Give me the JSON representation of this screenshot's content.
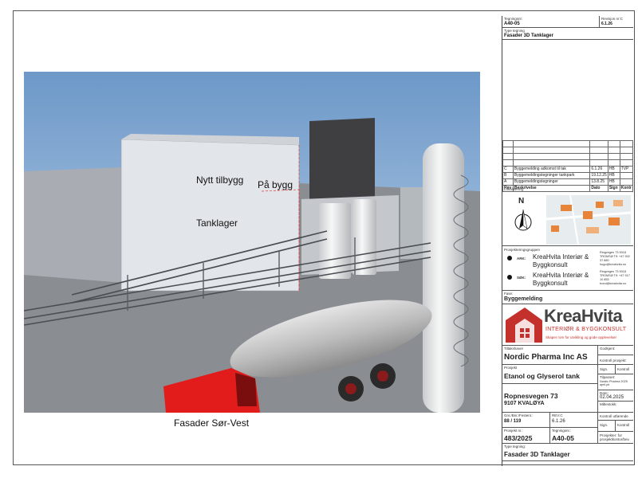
{
  "drawing": {
    "caption": "Fasader Sør-Vest",
    "labels": {
      "new_building": "Nytt tilbygg",
      "on_building": "På bygg",
      "tank_storage": "Tanklager"
    }
  },
  "title_block": {
    "header": {
      "drawing_no_label": "Tegningsnr:",
      "drawing_no": "A40-05",
      "revision_label": "Revisjon nr:C",
      "revision_date": "6.1.26",
      "type_label": "Type tegning",
      "type_value": "Fasader 3D Tanklager"
    },
    "revisions": {
      "rows": [
        {
          "rev": "C",
          "desc": "Byggemelding adkomst til tak",
          "date": "6.1.26",
          "sign": "HB",
          "ctrl": "TVP"
        },
        {
          "rev": "B",
          "desc": "Byggemeldingstegninger tankpark",
          "date": "19.12.25",
          "sign": "HB",
          "ctrl": ""
        },
        {
          "rev": "A",
          "desc": "Byggemeldingstegninger",
          "date": "13.8.25",
          "sign": "HB",
          "ctrl": ""
        }
      ],
      "headers": [
        "Rev",
        "Nr",
        "Beskrivelse",
        "Dato",
        "Sign",
        "Kontr"
      ]
    },
    "location": {
      "label": "Lokalisering:",
      "north": "N"
    },
    "project_group": {
      "label": "Prosjekteringsgruppen",
      "ark_label": "ARK:",
      "ark_name": "KreaHvita Interiør & Byggkonsult",
      "ark_address": "Ringvegen 73 9018 TROMSØ Tlf: +47 902 37 880 hugo@kreahvita.no",
      "sok_label": "SØK:",
      "sok_name": "KreaHvita Interiør & Byggkonsult",
      "sok_address": "Ringvegen 73 9018 TROMSØ Tlf: +47 917 10 855 trond@kreahvita.no"
    },
    "phase": {
      "label": "Fase:",
      "value": "Byggemelding"
    },
    "logo": {
      "name": "KreaHvita",
      "line1": "INTERIØR & BYGGKONSULT",
      "slogan": "Skaper rom for utvikling og gode opplevelser"
    },
    "client": {
      "label": "Tiltakshaver",
      "value": "Nordic Pharma Inc AS",
      "approved_label": "Godkjent:",
      "control_label": "Kontroll prosjekt:",
      "sign_label": "Sign.",
      "kontroll_label": "Kontroll"
    },
    "project": {
      "label": "Prosjekt",
      "value": "Etanol og Glyserol tank",
      "address1": "Ropnesvegen 73",
      "address2": "9107 KVALØYA",
      "tilpasset_label": "Tilpasset:",
      "tilpasset_value": "Nordic Pharma 2025 april.pir",
      "date_label": "Dato:",
      "date_value": "02.04.2025",
      "scale_label": "Målestokk:",
      "external_control_label": "Kontroll utførende"
    },
    "footer": {
      "drawing_count_label": "Gnr./Bnr./Festenr.:",
      "drawing_count": "88 / 119",
      "rev_label": "REV:C",
      "rev_value": "6.1.26",
      "sign_label": "Sign.",
      "kontroll_label": "Kontroll",
      "project_no_label": "Prosjekt nr.:",
      "project_no": "483/2025",
      "drawing_no_label": "Tegningsnr.:",
      "drawing_no": "A40-05",
      "project_for_label": "Prosjekter: for",
      "project_for_value": "prosjektkontor/bev.",
      "type_label": "Type tegning:",
      "type_value": "Fasader 3D Tanklager"
    }
  }
}
